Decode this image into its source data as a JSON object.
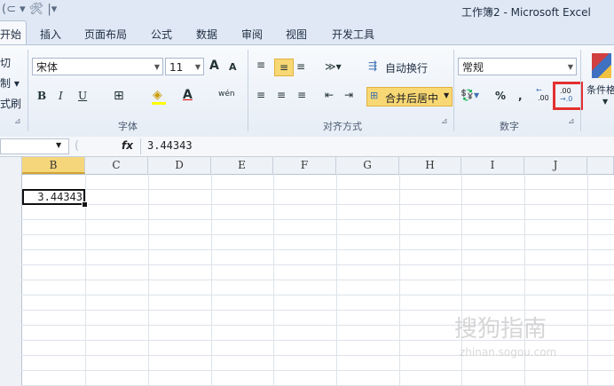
{
  "quick_access": {
    "icons": "(⊂ ▾ 🛠 |▾"
  },
  "window": {
    "title": "工作簿2 - Microsoft Excel"
  },
  "tabs": [
    "开始",
    "插入",
    "页面布局",
    "公式",
    "数据",
    "审阅",
    "视图",
    "开发工具"
  ],
  "clipboard": {
    "cut": "切",
    "copy": "制 ▾",
    "format_painter": "式刷"
  },
  "font": {
    "name": "宋体",
    "size": "11",
    "grow": "A",
    "shrink": "A",
    "bold": "B",
    "italic": "I",
    "underline": "U",
    "border": "⊞",
    "fill_color": "◈",
    "font_color": "A",
    "phonetic": "wén",
    "group_label": "字体"
  },
  "alignment": {
    "wrap_text": "自动换行",
    "merge_center": "合并后居中",
    "group_label": "对齐方式"
  },
  "number": {
    "format": "常规",
    "percent": "%",
    "comma": ",",
    "inc_decimal": ".00",
    "dec_decimal": ".00",
    "group_label": "数字"
  },
  "styles": {
    "conditional_format": "条件格"
  },
  "formula_bar": {
    "fx": "fx",
    "value": "3.44343"
  },
  "columns": [
    "B",
    "C",
    "D",
    "E",
    "F",
    "G",
    "H",
    "I",
    "J"
  ],
  "active_cell": {
    "value": "3.44343"
  },
  "watermark": {
    "main": "搜狗指南",
    "sub": "zhinan.sogou.com"
  },
  "colors": {
    "accent_red": "#e43030",
    "selected_header": "#f5d67a"
  }
}
